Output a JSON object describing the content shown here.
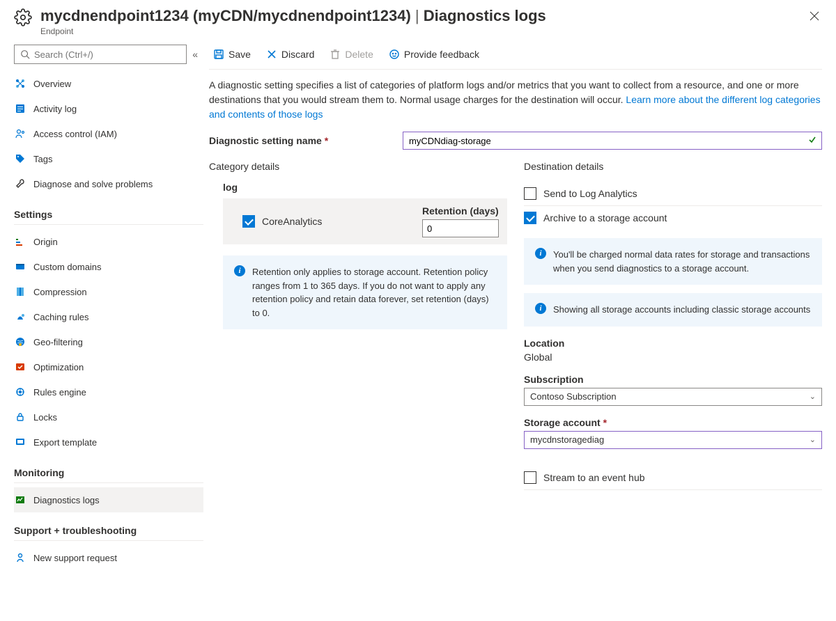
{
  "header": {
    "title_main": "mycdnendpoint1234 (myCDN/mycdnendpoint1234)",
    "title_section": "Diagnostics logs",
    "subtitle": "Endpoint"
  },
  "sidebar": {
    "search_placeholder": "Search (Ctrl+/)",
    "top_items": [
      {
        "label": "Overview"
      },
      {
        "label": "Activity log"
      },
      {
        "label": "Access control (IAM)"
      },
      {
        "label": "Tags"
      },
      {
        "label": "Diagnose and solve problems"
      }
    ],
    "sections": [
      {
        "title": "Settings",
        "items": [
          {
            "label": "Origin"
          },
          {
            "label": "Custom domains"
          },
          {
            "label": "Compression"
          },
          {
            "label": "Caching rules"
          },
          {
            "label": "Geo-filtering"
          },
          {
            "label": "Optimization"
          },
          {
            "label": "Rules engine"
          },
          {
            "label": "Locks"
          },
          {
            "label": "Export template"
          }
        ]
      },
      {
        "title": "Monitoring",
        "items": [
          {
            "label": "Diagnostics logs",
            "selected": true
          }
        ]
      },
      {
        "title": "Support + troubleshooting",
        "items": [
          {
            "label": "New support request"
          }
        ]
      }
    ]
  },
  "toolbar": {
    "save": "Save",
    "discard": "Discard",
    "delete": "Delete",
    "feedback": "Provide feedback"
  },
  "description": {
    "text": "A diagnostic setting specifies a list of categories of platform logs and/or metrics that you want to collect from a resource, and one or more destinations that you would stream them to. Normal usage charges for the destination will occur. ",
    "link": "Learn more about the different log categories and contents of those logs"
  },
  "setting_name": {
    "label": "Diagnostic setting name",
    "value": "myCDNdiag-storage"
  },
  "category": {
    "title": "Category details",
    "log_header": "log",
    "retention_header": "Retention (days)",
    "items": [
      {
        "name": "CoreAnalytics",
        "checked": true,
        "retention": "0"
      }
    ],
    "info": "Retention only applies to storage account. Retention policy ranges from 1 to 365 days. If you do not want to apply any retention policy and retain data forever, set retention (days) to 0."
  },
  "destination": {
    "title": "Destination details",
    "options": [
      {
        "label": "Send to Log Analytics",
        "checked": false
      },
      {
        "label": "Archive to a storage account",
        "checked": true
      },
      {
        "label": "Stream to an event hub",
        "checked": false
      }
    ],
    "info1": "You'll be charged normal data rates for storage and transactions when you send diagnostics to a storage account.",
    "info2": "Showing all storage accounts including classic storage accounts",
    "location_label": "Location",
    "location_value": "Global",
    "subscription_label": "Subscription",
    "subscription_value": "Contoso Subscription",
    "storage_label": "Storage account",
    "storage_value": "mycdnstoragediag"
  }
}
